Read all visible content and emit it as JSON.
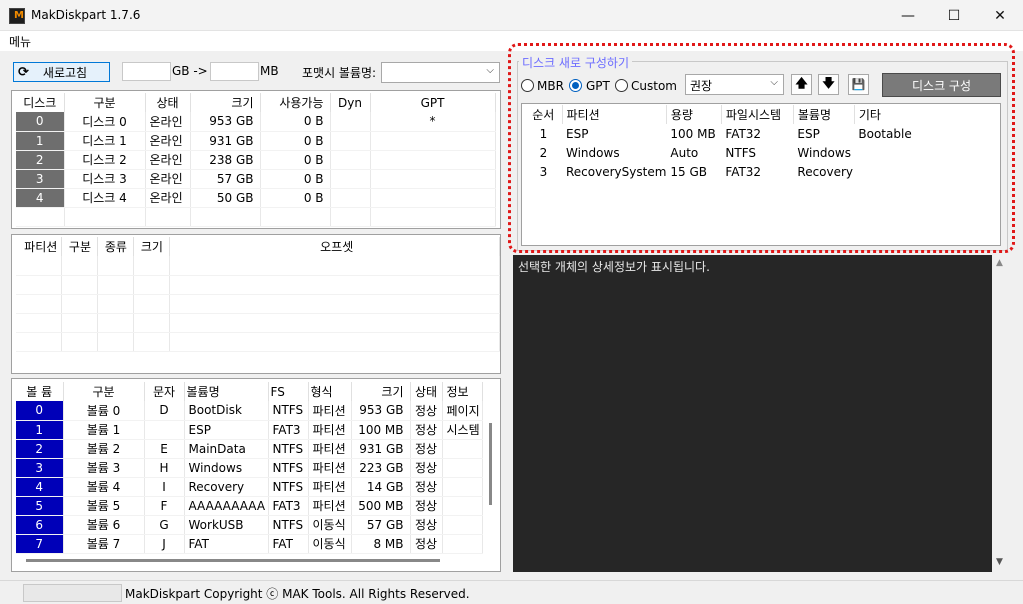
{
  "window": {
    "title": "MakDiskpart 1.7.6",
    "icon_letter": "M",
    "minimize": "—",
    "maximize": "☐",
    "close": "✕"
  },
  "menu": {
    "label": "메뉴"
  },
  "controls": {
    "refresh_label": "새로고침",
    "refresh_icon": "⟳",
    "gb_value": "",
    "gb_label": "GB ->",
    "mb_value": "",
    "mb_label": "MB",
    "volume_label_caption": "포맷시 볼륨명:",
    "volume_label_value": ""
  },
  "disk_table": {
    "headers": [
      "디스크",
      "구분",
      "상태",
      "크기",
      "사용가능",
      "Dyn",
      "GPT"
    ],
    "rows": [
      {
        "index": "0",
        "name": "디스크 0",
        "status": "온라인",
        "size": "953 GB",
        "free": "0 B",
        "dyn": "",
        "gpt": "*"
      },
      {
        "index": "1",
        "name": "디스크 1",
        "status": "온라인",
        "size": "931 GB",
        "free": "0 B",
        "dyn": "",
        "gpt": ""
      },
      {
        "index": "2",
        "name": "디스크 2",
        "status": "온라인",
        "size": "238 GB",
        "free": "0 B",
        "dyn": "",
        "gpt": ""
      },
      {
        "index": "3",
        "name": "디스크 3",
        "status": "온라인",
        "size": "57 GB",
        "free": "0 B",
        "dyn": "",
        "gpt": ""
      },
      {
        "index": "4",
        "name": "디스크 4",
        "status": "온라인",
        "size": "50 GB",
        "free": "0 B",
        "dyn": "",
        "gpt": ""
      }
    ]
  },
  "partition_table": {
    "headers": [
      "파티션",
      "구분",
      "종류",
      "크기",
      "오프셋"
    ]
  },
  "volume_table": {
    "headers": [
      "볼 륨",
      "구분",
      "문자",
      "볼륨명",
      "FS",
      "형식",
      "크기",
      "상태",
      "정보"
    ],
    "rows": [
      {
        "index": "0",
        "name": "볼륨 0",
        "letter": "D",
        "label": "BootDisk",
        "fs": "NTFS",
        "type": "파티션",
        "size": "953 GB",
        "status": "정상",
        "info": "페이지"
      },
      {
        "index": "1",
        "name": "볼륨 1",
        "letter": "",
        "label": "ESP",
        "fs": "FAT3",
        "type": "파티션",
        "size": "100 MB",
        "status": "정상",
        "info": "시스템"
      },
      {
        "index": "2",
        "name": "볼륨 2",
        "letter": "E",
        "label": "MainData",
        "fs": "NTFS",
        "type": "파티션",
        "size": "931 GB",
        "status": "정상",
        "info": ""
      },
      {
        "index": "3",
        "name": "볼륨 3",
        "letter": "H",
        "label": "Windows",
        "fs": "NTFS",
        "type": "파티션",
        "size": "223 GB",
        "status": "정상",
        "info": ""
      },
      {
        "index": "4",
        "name": "볼륨 4",
        "letter": "I",
        "label": "Recovery",
        "fs": "NTFS",
        "type": "파티션",
        "size": "14 GB",
        "status": "정상",
        "info": ""
      },
      {
        "index": "5",
        "name": "볼륨 5",
        "letter": "F",
        "label": "AAAAAAAAA",
        "fs": "FAT3",
        "type": "파티션",
        "size": "500 MB",
        "status": "정상",
        "info": ""
      },
      {
        "index": "6",
        "name": "볼륨 6",
        "letter": "G",
        "label": "WorkUSB",
        "fs": "NTFS",
        "type": "이동식",
        "size": "57 GB",
        "status": "정상",
        "info": ""
      },
      {
        "index": "7",
        "name": "볼륨 7",
        "letter": "J",
        "label": "FAT",
        "fs": "FAT",
        "type": "이동식",
        "size": "8 MB",
        "status": "정상",
        "info": ""
      }
    ]
  },
  "reconfigure": {
    "group_title": "디스크 새로 구성하기",
    "radio_mbr": "MBR",
    "radio_gpt": "GPT",
    "radio_custom": "Custom",
    "selected_scheme": "GPT",
    "preset_value": "권장",
    "up_icon": "🡅",
    "down_icon": "🡇",
    "save_icon": "💾",
    "configure_label": "디스크 구성",
    "headers": [
      "순서",
      "파티션",
      "용량",
      "파일시스템",
      "볼륨명",
      "기타"
    ],
    "rows": [
      {
        "order": "1",
        "partition": "ESP",
        "capacity": "100 MB",
        "fs": "FAT32",
        "volume": "ESP",
        "etc": "Bootable"
      },
      {
        "order": "2",
        "partition": "Windows",
        "capacity": "Auto",
        "fs": "NTFS",
        "volume": "Windows",
        "etc": ""
      },
      {
        "order": "3",
        "partition": "RecoverySystem",
        "capacity": "15 GB",
        "fs": "FAT32",
        "volume": "Recovery",
        "etc": ""
      }
    ]
  },
  "detail": {
    "text": "선택한 개체의 상세정보가 표시됩니다."
  },
  "status": {
    "copyright": "MakDiskpart Copyright ⓒ MAK Tools. All Rights Reserved."
  },
  "colors": {
    "accent": "#0078d7",
    "disk_index": "#6e6e6e",
    "volume_index": "#0000b8",
    "highlight_border": "#e01818",
    "detail_bg": "#262626"
  }
}
